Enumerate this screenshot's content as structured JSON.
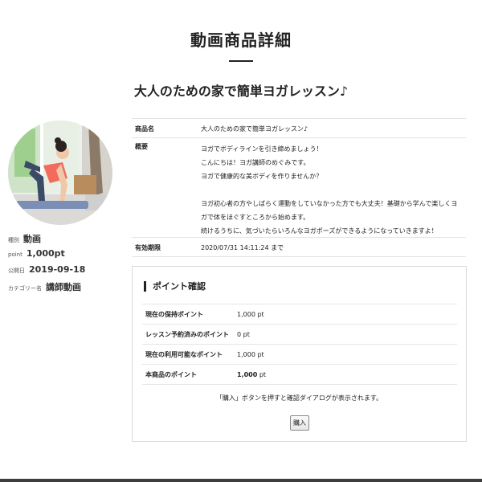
{
  "header": {
    "page_title": "動画商品詳細",
    "product_title": "大人のための家で簡単ヨガレッスン♪"
  },
  "sidebar": {
    "type_label": "種別",
    "type_value": "動画",
    "point_label": "point",
    "point_value": "1,000pt",
    "published_label": "公開日",
    "published_value": "2019-09-18",
    "category_label": "カテゴリー名",
    "category_value": "講師動画"
  },
  "details": {
    "name_label": "商品名",
    "name_value": "大人のための家で簡単ヨガレッスン♪",
    "overview_label": "概要",
    "overview_lines": [
      "ヨガでボディラインを引き締めましょう！",
      "こんにちは！ヨガ講師のめぐみです。",
      "ヨガで健康的な美ボディを作りませんか？",
      "",
      "ヨガ初心者の方やしばらく運動をしていなかった方でも大丈夫！基礎から学んで楽しくヨ",
      "ガで体をほぐすところから始めます。",
      "続けるうちに、気づいたらいろんなヨガポーズができるようになっていきますよ！"
    ],
    "expiry_label": "有効期限",
    "expiry_value": "2020/07/31 14:11:24 まで"
  },
  "points": {
    "heading": "ポイント確認",
    "rows": [
      {
        "label": "現在の保持ポイント",
        "amount": "1,000",
        "unit": " pt"
      },
      {
        "label": "レッスン予約済みのポイント",
        "amount": "0",
        "unit": " pt"
      },
      {
        "label": "現在の利用可能なポイント",
        "amount": "1,000",
        "unit": " pt"
      },
      {
        "label": "本商品のポイント",
        "amount": "1,000",
        "unit": " pt"
      }
    ],
    "notice": "「購入」ボタンを押すと確認ダイアログが表示されます。",
    "buy_label": "購入"
  },
  "colors": {
    "text": "#222222",
    "border": "#e4e4e4",
    "footer_bar": "#3d3d3d"
  }
}
